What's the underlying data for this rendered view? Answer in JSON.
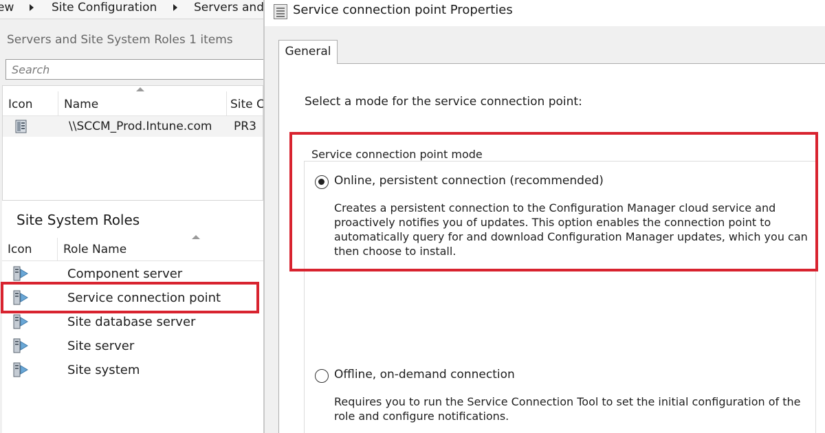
{
  "breadcrumb": {
    "items": [
      "ew",
      "Site Configuration",
      "Servers and"
    ]
  },
  "servers_panel": {
    "header": "Servers and Site System Roles 1 items",
    "search_placeholder": "Search",
    "columns": [
      "Icon",
      "Name",
      "Site C"
    ],
    "rows": [
      {
        "icon": "server-icon",
        "name": "\\\\SCCM_Prod.Intune.com",
        "site": "PR3"
      }
    ]
  },
  "roles_panel": {
    "title": "Site System Roles",
    "columns": [
      "Icon",
      "Role Name"
    ],
    "rows": [
      {
        "icon": "role-icon",
        "label": "Component server"
      },
      {
        "icon": "role-icon",
        "label": "Service connection point",
        "highlighted": true
      },
      {
        "icon": "role-icon",
        "label": "Site database server"
      },
      {
        "icon": "role-icon",
        "label": "Site server"
      },
      {
        "icon": "role-icon",
        "label": "Site system"
      }
    ]
  },
  "dialog": {
    "title": "Service connection point Properties",
    "tab": "General",
    "prompt": "Select a mode for the service connection point:",
    "group_label": "Service connection point mode",
    "options": [
      {
        "label": "Online, persistent connection (recommended)",
        "selected": true,
        "description": "Creates a persistent connection to the Configuration Manager cloud service and proactively notifies you of updates. This option enables the connection point to automatically query for and download Configuration Manager updates, which you can then choose to install."
      },
      {
        "label": "Offline, on-demand connection",
        "selected": false,
        "description": "Requires you to run the Service Connection Tool to set the initial configuration of the role and configure notifications."
      }
    ]
  },
  "colors": {
    "highlight": "#d8232f",
    "pane_background": "#f0f0f0"
  }
}
